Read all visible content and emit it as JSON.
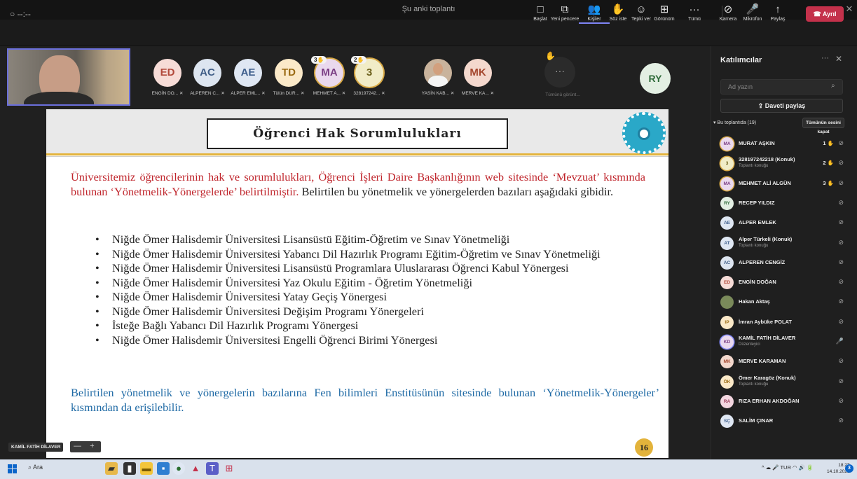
{
  "window": {
    "title": "Şu anki toplantı",
    "timer": "○ --:--"
  },
  "toolbar": {
    "items": [
      {
        "label": "Başlat",
        "icon": "□"
      },
      {
        "label": "Yeni pencere",
        "icon": "⧉"
      },
      {
        "label": "Kişiler",
        "icon": "👥"
      },
      {
        "label": "Söz iste",
        "icon": "✋"
      },
      {
        "label": "Tepki ver",
        "icon": "☺"
      },
      {
        "label": "Görünüm",
        "icon": "⊞"
      },
      {
        "label": "Tümü",
        "icon": "···"
      },
      {
        "label": "Kamera",
        "icon": "⊘"
      },
      {
        "label": "Mikrofon",
        "icon": "🎤"
      },
      {
        "label": "Paylaş",
        "icon": "↑"
      }
    ],
    "leave": "Ayrıl"
  },
  "tiles": [
    {
      "initials": "ED",
      "name": "ENGİN DO...",
      "bg": "#f7dcd7",
      "fg": "#b2493b"
    },
    {
      "initials": "AC",
      "name": "ALPEREN C...",
      "bg": "#dde5f0",
      "fg": "#3f5d86"
    },
    {
      "initials": "AE",
      "name": "ALPER EML...",
      "bg": "#dfe7f3",
      "fg": "#3e5e8c"
    },
    {
      "initials": "TD",
      "name": "Tülün DUR...",
      "bg": "#fbe9c8",
      "fg": "#9a6a12"
    },
    {
      "initials": "MA",
      "name": "MEHMET A...",
      "bg": "#ead9ee",
      "fg": "#7a3d84",
      "hand": "3"
    },
    {
      "initials": "3",
      "name": "328197242...",
      "bg": "#f1ecc7",
      "fg": "#6b5f1a",
      "hand": "2"
    },
    {
      "initials": "",
      "name": "YASİN KAB...",
      "bg": "#c9b39c",
      "fg": "#333"
    },
    {
      "initials": "MK",
      "name": "MERVE KA...",
      "bg": "#f4d8cd",
      "fg": "#a5472e"
    }
  ],
  "stage": {
    "more_label": "Tümünü görünt...",
    "ry": "RY"
  },
  "slide": {
    "title": "Öğrenci Hak Sorumlulukları",
    "intro_red": "Üniversitemiz öğrencilerinin hak ve sorumlulukları, Öğrenci İşleri Daire Başkanlığının web sitesinde ‘Mevzuat’ kısmında bulunan ‘Yönetmelik-Yönergelerde’ belirtilmiştir.",
    "intro_black": "Belirtilen bu yönetmelik ve yönergelerden bazıları aşağıdaki gibidir.",
    "bullets": [
      "Niğde Ömer Halisdemir Üniversitesi Lisansüstü Eğitim-Öğretim ve Sınav Yönetmeliği",
      "Niğde Ömer Halisdemir Üniversitesi Yabancı Dil Hazırlık Programı Eğitim-Öğretim ve Sınav Yönetmeliği",
      "Niğde Ömer Halisdemir Üniversitesi Lisansüstü Programlara Uluslararası Öğrenci Kabul Yönergesi",
      "Niğde  Ömer Halisdemir Üniversitesi Yaz Okulu Eğitim - Öğretim Yönetmeliği",
      "Niğde Ömer Halisdemir Üniversitesi Yatay Geçiş Yönergesi",
      "Niğde Ömer Halisdemir Üniversitesi Değişim Programı Yönergeleri",
      "İsteğe Bağlı Yabancı Dil Hazırlık Programı Yönergesi",
      "Niğde Ömer Halisdemir Üniversitesi Engelli Öğrenci Birimi Yönergesi"
    ],
    "outro": "Belirtilen yönetmelik ve yönergelerin bazılarına Fen bilimleri Enstitüsünün sitesinde bulunan ‘Yönetmelik-Yönergeler’ kısmından da erişilebilir.",
    "page": "16"
  },
  "presenter": {
    "name": "KAMİL FATİH DİLAVER",
    "zoom_minus": "—",
    "zoom_plus": "+"
  },
  "panel": {
    "title": "Katılımcılar",
    "more": "···",
    "close": "✕",
    "search_placeholder": "Ad yazın",
    "share_invite": "Daveti paylaş",
    "section": "▾ Bu toplantıda (19)",
    "mute_all": "Tümünün sesini kapat",
    "participants": [
      {
        "initials": "MA",
        "name": "MURAT AŞKIN",
        "bg": "#ead9ee",
        "fg": "#7a3d84",
        "ring": "gold",
        "hand": "1"
      },
      {
        "initials": "3",
        "name": "328197242218 (Konuk)",
        "sub": "Toplantı konuğu",
        "bg": "#f1ecc7",
        "fg": "#6b5f1a",
        "ring": "gold",
        "hand": "2"
      },
      {
        "initials": "MA",
        "name": "MEHMET ALİ ALGÜN",
        "bg": "#ead9ee",
        "fg": "#7a3d84",
        "ring": "gold",
        "hand": "3"
      },
      {
        "initials": "RY",
        "name": "RECEP YILDIZ",
        "bg": "#e3efe3",
        "fg": "#2f6b3a"
      },
      {
        "initials": "AE",
        "name": "ALPER EMLEK",
        "bg": "#dfe7f3",
        "fg": "#3e5e8c"
      },
      {
        "initials": "AT",
        "name": "Alper Türkeli (Konuk)",
        "sub": "Toplantı konuğu",
        "bg": "#dfe7f3",
        "fg": "#3e5e8c"
      },
      {
        "initials": "AC",
        "name": "ALPEREN CENGİZ",
        "bg": "#dde5f0",
        "fg": "#3f5d86"
      },
      {
        "initials": "ED",
        "name": "ENGİN DOĞAN",
        "bg": "#f7dcd7",
        "fg": "#b2493b"
      },
      {
        "initials": "",
        "name": "Hakan Aktaş",
        "bg": "#7a8a5a",
        "fg": "#fff"
      },
      {
        "initials": "IP",
        "name": "İmran Aybüke POLAT",
        "bg": "#fbe9c8",
        "fg": "#9a6a12"
      },
      {
        "initials": "KD",
        "name": "KAMİL FATİH DİLAVER",
        "sub": "Düzenleyici",
        "bg": "#ead9ee",
        "fg": "#7a3d84",
        "ring": "blue",
        "micOn": true
      },
      {
        "initials": "MK",
        "name": "MERVE KARAMAN",
        "bg": "#f4d8cd",
        "fg": "#a5472e"
      },
      {
        "initials": "ÖK",
        "name": "Ömer Karagöz (Konuk)",
        "sub": "Toplantı konuğu",
        "bg": "#fbe9c8",
        "fg": "#9a6a12"
      },
      {
        "initials": "RA",
        "name": "RIZA ERHAN AKDOĞAN",
        "bg": "#f3d6e0",
        "fg": "#9b3a5a"
      },
      {
        "initials": "SÇ",
        "name": "SALİM ÇINAR",
        "bg": "#dfe7f3",
        "fg": "#3e5e8c"
      }
    ]
  },
  "taskbar": {
    "search": "Ara",
    "tray": "^  ☁  🎤  TUR  ◠  🔊  🔋",
    "time": "18:27",
    "date": "14.10.2023",
    "notifications": "3"
  }
}
